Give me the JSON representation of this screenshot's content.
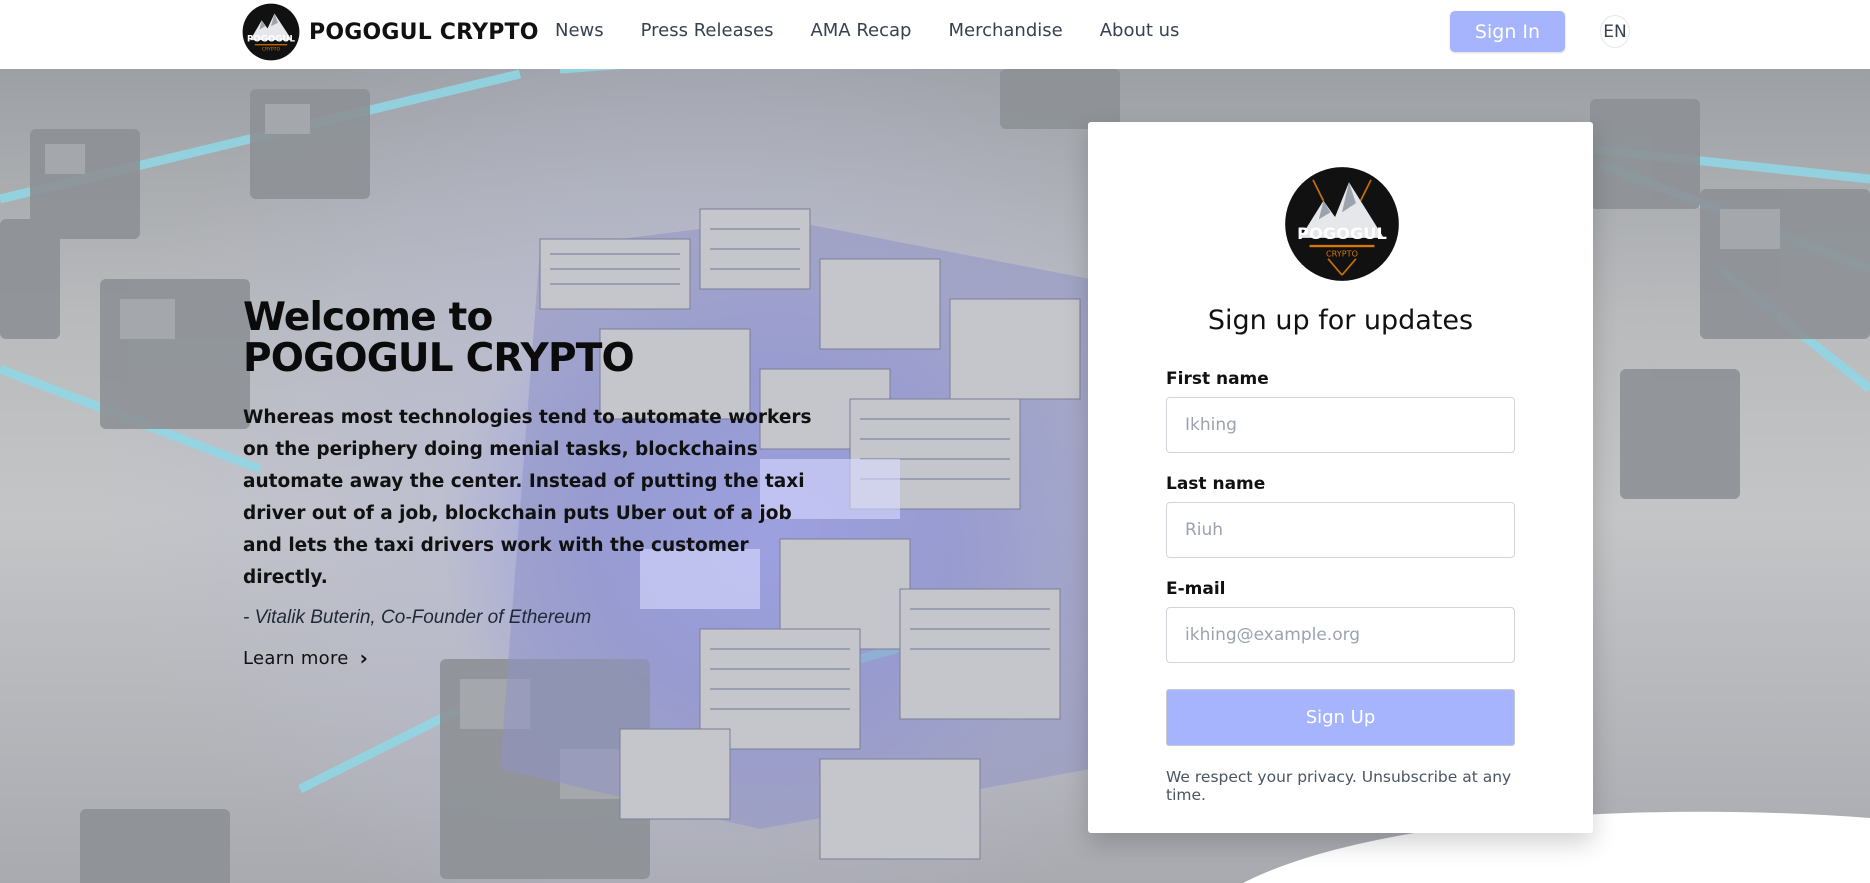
{
  "nav": {
    "brand": "POGOGUL CRYPTO",
    "logo_text": "POGOGUL",
    "logo_subtext": "CRYPTO",
    "links": [
      "News",
      "Press Releases",
      "AMA Recap",
      "Merchandise",
      "About us"
    ],
    "sign_in": "Sign In",
    "lang": "EN"
  },
  "hero": {
    "title_line1": "Welcome to",
    "title_line2": "POGOGUL CRYPTO",
    "quote": "Whereas most technologies tend to automate workers on the periphery doing menial tasks, blockchains automate away the center. Instead of putting the taxi driver out of a job, blockchain puts Uber out of a job and lets the taxi drivers work with the customer directly.",
    "author": "- Vitalik Buterin, Co-Founder of Ethereum",
    "learn_more": "Learn more"
  },
  "signup": {
    "title": "Sign up for updates",
    "first_name_label": "First name",
    "first_name_placeholder": "Ikhing",
    "last_name_label": "Last name",
    "last_name_placeholder": "Riuh",
    "email_label": "E-mail",
    "email_placeholder": "ikhing@example.org",
    "button": "Sign Up",
    "privacy": "We respect your privacy. Unsubscribe at any time."
  },
  "colors": {
    "accent": "#a5b4fc",
    "hero_glow": "#aab0ff",
    "beam": "#8fd8e6"
  }
}
